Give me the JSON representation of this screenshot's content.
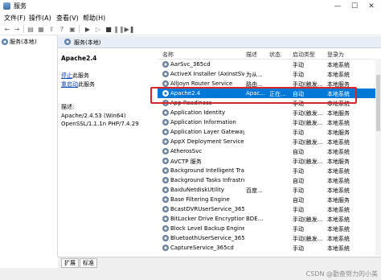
{
  "window": {
    "title": "服务",
    "minimize": "—",
    "maximize": "☐",
    "close": "✕"
  },
  "menu": [
    "文件(F)",
    "操作(A)",
    "查看(V)",
    "帮助(H)"
  ],
  "tree": {
    "item_label": "服务(本地)"
  },
  "pane": {
    "header_label": "服务(本地)"
  },
  "details": {
    "service_name": "Apache2.4",
    "stop_link": "停止",
    "stop_suffix": "此服务",
    "restart_link": "重启动",
    "restart_suffix": "此服务",
    "desc_label": "描述:",
    "desc_line1": "Apache/2.4.53 (Win64)",
    "desc_line2": "OpenSSL/1.1.1n PHP/7.4.29"
  },
  "columns": {
    "name": "名称",
    "desc": "描述",
    "status": "状态",
    "startup": "启动类型",
    "logon": "登录为"
  },
  "rows": [
    {
      "name": "AarSvc_365cd",
      "desc": "",
      "status": "",
      "startup": "手动",
      "logon": "本地系统"
    },
    {
      "name": "ActiveX Installer (AxInstSV)",
      "desc": "为从...",
      "status": "",
      "startup": "手动",
      "logon": "本地系统"
    },
    {
      "name": "AllJoyn Router Service",
      "desc": "路由...",
      "status": "",
      "startup": "手动(触发...",
      "logon": "本地服务"
    },
    {
      "name": "Apache2.4",
      "desc": "Apac...",
      "status": "正在...",
      "startup": "自动",
      "logon": "本地系统"
    },
    {
      "name": "App Readiness",
      "desc": "",
      "status": "",
      "startup": "手动",
      "logon": "本地系统"
    },
    {
      "name": "Application Identity",
      "desc": "",
      "status": "",
      "startup": "手动(触发...",
      "logon": "本地服务"
    },
    {
      "name": "Application Information",
      "desc": "",
      "status": "",
      "startup": "手动(触发...",
      "logon": "本地系统"
    },
    {
      "name": "Application Layer Gateway ...",
      "desc": "",
      "status": "",
      "startup": "手动",
      "logon": "本地服务"
    },
    {
      "name": "AppX Deployment Service ...",
      "desc": "",
      "status": "",
      "startup": "手动(触发...",
      "logon": "本地系统"
    },
    {
      "name": "AtherosSvc",
      "desc": "",
      "status": "",
      "startup": "自动",
      "logon": "本地系统"
    },
    {
      "name": "AVCTP 服务",
      "desc": "",
      "status": "",
      "startup": "手动(触发...",
      "logon": "本地服务"
    },
    {
      "name": "Background Intelligent Tra...",
      "desc": "",
      "status": "",
      "startup": "手动",
      "logon": "本地系统"
    },
    {
      "name": "Background Tasks Infrastru...",
      "desc": "",
      "status": "",
      "startup": "自动",
      "logon": "本地系统"
    },
    {
      "name": "BaiduNetdiskUtility",
      "desc": "百度...",
      "status": "",
      "startup": "手动",
      "logon": "本地系统"
    },
    {
      "name": "Base Filtering Engine",
      "desc": "",
      "status": "",
      "startup": "自动",
      "logon": "本地服务"
    },
    {
      "name": "BcastDVRUserService_365...",
      "desc": "",
      "status": "",
      "startup": "手动",
      "logon": "本地系统"
    },
    {
      "name": "BitLocker Drive Encryption ...",
      "desc": "BDE...",
      "status": "",
      "startup": "手动(触发...",
      "logon": "本地系统"
    },
    {
      "name": "Block Level Backup Engine ...",
      "desc": "",
      "status": "",
      "startup": "手动",
      "logon": "本地系统"
    },
    {
      "name": "BluetoothUserService_365...",
      "desc": "",
      "status": "",
      "startup": "手动(触发...",
      "logon": "本地系统"
    },
    {
      "name": "CaptureService_365cd",
      "desc": "",
      "status": "",
      "startup": "手动",
      "logon": "本地系统"
    }
  ],
  "tabs": [
    "扩展",
    "标准"
  ],
  "watermark": "CSDN @勤奋努力的小美",
  "colors": {
    "selection": "#0078d7",
    "highlight_box": "#d9262b",
    "link": "#0645ad"
  }
}
